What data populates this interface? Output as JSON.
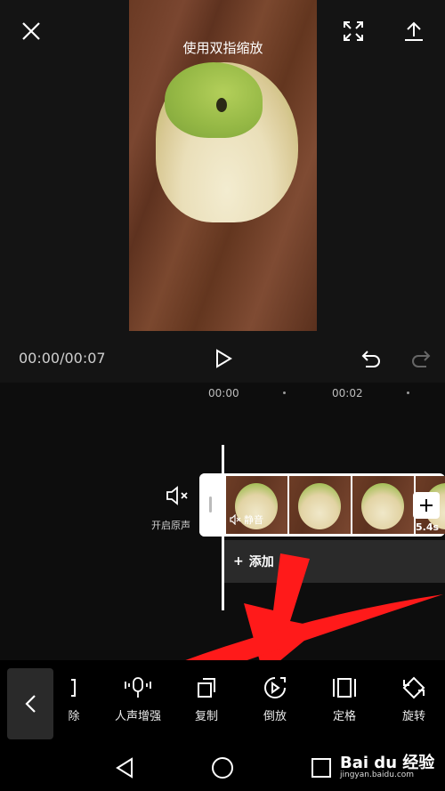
{
  "preview": {
    "hint": "使用双指缩放",
    "time": "00:00/00:07"
  },
  "timeline": {
    "ruler": [
      "00:00",
      "00:02"
    ],
    "original_sound_label": "开启原声",
    "clip_mute_label": "静音",
    "clip_duration": "5.4s",
    "add_audio_label": "添加"
  },
  "toolbar": {
    "items": [
      {
        "label": "除",
        "icon": "split-icon"
      },
      {
        "label": "人声增强",
        "icon": "mic-icon"
      },
      {
        "label": "复制",
        "icon": "copy-icon"
      },
      {
        "label": "倒放",
        "icon": "reverse-icon"
      },
      {
        "label": "定格",
        "icon": "freeze-icon"
      },
      {
        "label": "旋转",
        "icon": "rotate-icon"
      }
    ]
  },
  "watermark": {
    "brand": "Bai du 经验",
    "url": "jingyan.baidu.com"
  },
  "colors": {
    "background": "#0d0d0d",
    "arrow": "#ff1a1a"
  }
}
